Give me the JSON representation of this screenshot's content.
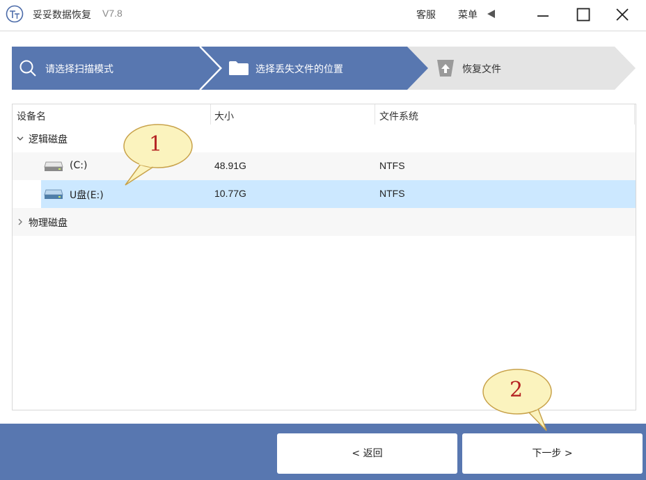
{
  "app": {
    "name": "妥妥数据恢复",
    "version": "V7.8"
  },
  "titlebar": {
    "service_label": "客服",
    "menu_label": "菜单"
  },
  "steps": [
    {
      "label": "请选择扫描模式",
      "icon": "search-icon",
      "state": "done"
    },
    {
      "label": "选择丢失文件的位置",
      "icon": "folder-icon",
      "state": "active"
    },
    {
      "label": "恢复文件",
      "icon": "upload-icon",
      "state": "pending"
    }
  ],
  "table": {
    "headers": [
      "设备名",
      "大小",
      "文件系统"
    ],
    "groups": [
      {
        "label": "逻辑磁盘",
        "expanded": true
      },
      {
        "label": "物理磁盘",
        "expanded": false
      }
    ],
    "drives": [
      {
        "name": "(C:)",
        "size": "48.91G",
        "fs": "NTFS",
        "selected": false
      },
      {
        "name": "U盘(E:)",
        "size": "10.77G",
        "fs": "NTFS",
        "selected": true
      }
    ]
  },
  "callouts": [
    "1",
    "2"
  ],
  "footer": {
    "back_label": "< 返回",
    "next_label": "下一步 >"
  },
  "colors": {
    "accent": "#5877b0",
    "selection": "#cce8ff",
    "step_pending": "#e4e4e4"
  }
}
